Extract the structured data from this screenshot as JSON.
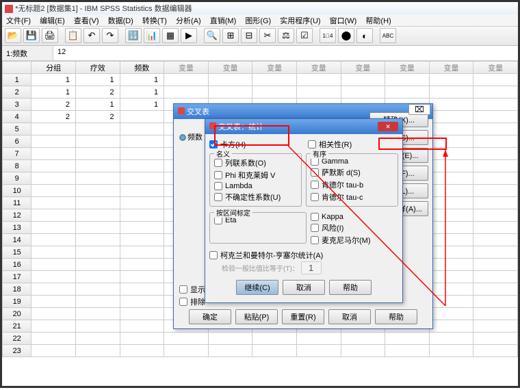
{
  "window": {
    "title": "*无标题2 [数据集1] - IBM SPSS Statistics 数据编辑器"
  },
  "menu": {
    "file": "文件(F)",
    "edit": "编辑(E)",
    "view": "查看(V)",
    "data": "数据(D)",
    "transform": "转换(T)",
    "analyze": "分析(A)",
    "direct": "直销(M)",
    "graphs": "图形(G)",
    "utilities": "实用程序(U)",
    "window": "窗口(W)",
    "help": "帮助(H)"
  },
  "cellbar": {
    "label": "1:频数",
    "value": "12"
  },
  "columns": [
    "分组",
    "疗效",
    "频数",
    "变量",
    "变量",
    "变量",
    "变量",
    "变量",
    "变量",
    "变量",
    "变量"
  ],
  "rows": [
    {
      "n": "1",
      "c": [
        "1",
        "1",
        "1"
      ]
    },
    {
      "n": "2",
      "c": [
        "1",
        "2",
        "1"
      ]
    },
    {
      "n": "3",
      "c": [
        "2",
        "1",
        "1"
      ]
    },
    {
      "n": "4",
      "c": [
        "2",
        "2",
        ""
      ]
    }
  ],
  "empty_rows": [
    "5",
    "6",
    "7",
    "8",
    "9",
    "10",
    "11",
    "12",
    "13",
    "14",
    "15",
    "16",
    "17",
    "18",
    "19",
    "20",
    "21",
    "22",
    "23"
  ],
  "crosstab": {
    "title": "交叉表",
    "close_sym": "⌧",
    "var_freq": "频数",
    "show_clustered": "显示",
    "suppress": "排除",
    "btns": {
      "ok": "确定",
      "paste": "粘贴(P)",
      "reset": "重置(R)",
      "cancel": "取消",
      "help": "帮助"
    },
    "side": {
      "exact": "精确(X)...",
      "stats": "统计(S)...",
      "cells": "单元格(E)...",
      "format": "格式(F)...",
      "style": "样式(L)...",
      "bootstrap": "自助抽样(A)..."
    }
  },
  "stats": {
    "title": "交叉表：统计",
    "close_sym": "✕",
    "chi": "卡方(H)",
    "corr": "相关性(R)",
    "nominal": "名义",
    "ordinal": "有序",
    "contingency": "列联系数(O)",
    "phi": "Phi 和克莱姆 V",
    "lambda": "Lambda",
    "uncertainty": "不确定性系数(U)",
    "gamma": "Gamma",
    "somers": "萨默斯 d(S)",
    "kendall_b": "肯德尔 tau-b",
    "kendall_c": "肯德尔 tau-c",
    "interval": "按区间标定",
    "eta": "Eta",
    "kappa": "Kappa",
    "risk": "风险(I)",
    "mcnemar": "麦克尼马尔(M)",
    "cochran": "柯克兰和曼特尔-亨塞尔统计(A)",
    "odds": "检验一般比值比等于(T)：",
    "odds_val": "1",
    "btns": {
      "cont": "继续(C)",
      "cancel": "取消",
      "help": "帮助"
    }
  }
}
